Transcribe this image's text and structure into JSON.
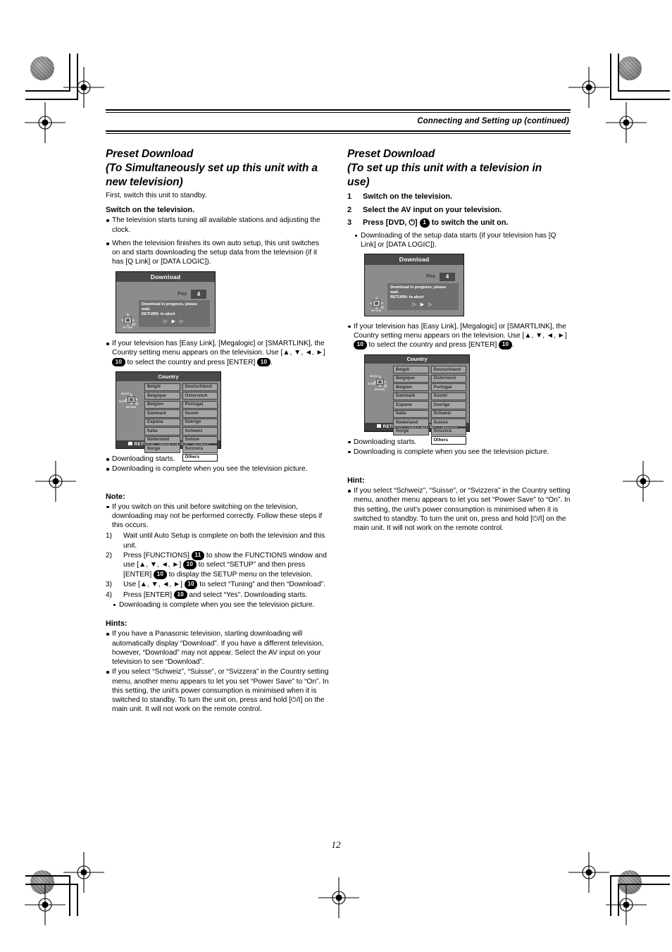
{
  "header": {
    "running_head": "Connecting and Setting up (continued)"
  },
  "page_number": "12",
  "left": {
    "title_line1": "Preset Download",
    "title_line2": "(To Simultaneously set up this unit with a",
    "title_line3": "new television)",
    "lead": "First, switch this unit to standby.",
    "subhead": "Switch on the television.",
    "bullet1": "The television starts tuning all available stations and adjusting the clock.",
    "bullet2": "When the television finishes its own auto setup, this unit switches on and starts downloading the setup data from the television (if it has [Q Link] or [DATA LOGIC]).",
    "bullet3_a": "If your television has [Easy Link], [Megalogic] or [SMARTLINK], the Country setting menu appears on the television. Use [",
    "bullet3_arrows": "▲, ▼, ◄, ►",
    "bullet3_b": "] ",
    "bullet3_key": "10",
    "bullet3_c": " to select the country and press [ENTER] ",
    "bullet3_key2": "10",
    "bullet3_d": ".",
    "bullet4": "Downloading starts.",
    "bullet5": "Downloading is complete when you see the television picture.",
    "note_head": "Note:",
    "note_bullet": "If you switch on this unit before switching on the television, downloading may not be performed correctly. Follow these steps if this occurs.",
    "steps": [
      {
        "n": "1)",
        "text": "Wait until Auto Setup is complete on both the television and this unit."
      },
      {
        "n": "2)",
        "text": "Press [FUNCTIONS] ⓫ to show the FUNCTIONS window and use [▲, ▼, ◄, ►] ⓪ to select “SETUP” and then press [ENTER] ⓪ to display the SETUP menu on the television."
      },
      {
        "n": "3)",
        "text": "Use [▲, ▼, ◄, ►] ⓪ to select “Tuning” and then “Download”."
      },
      {
        "n": "4)",
        "text": "Press [ENTER] ⓪ and select “Yes”. Downloading starts."
      }
    ],
    "step4_sub": "Downloading is complete when you see the television picture.",
    "hints_head": "Hints:",
    "hint1": "If you have a Panasonic television, starting downloading will automatically display “Download”. If you have a different television, however, “Download” may not appear. Select the AV input on your television to see “Download”.",
    "hint2": "If you select “Schweiz”, “Suisse”, or “Svizzera” in the Country setting menu, another menu appears to let you set “Power Save” to “On”. In this setting, the unit’s power consumption is minimised when it is switched to standby. To turn the unit on, press and hold [⏻/I] on the main unit. It will not work on the remote control."
  },
  "right": {
    "title_line1": "Preset Download",
    "title_line2": "(To set up this unit with a television in",
    "title_line3": "use)",
    "steps": [
      {
        "n": "1",
        "text": "Switch on the television."
      },
      {
        "n": "2",
        "text": "Select the AV input on your television."
      },
      {
        "n": "3",
        "text": "Press [DVD, ⏻] ① to switch the unit on."
      }
    ],
    "step3_key": "1",
    "step3_pre": "Press [DVD, ⏻] ",
    "step3_post": " to switch the unit on.",
    "bullet1": "Downloading of the setup data starts (if your television has [Q Link] or [DATA LOGIC]).",
    "bullet2_a": "If your television has [Easy Link], [Megalogic] or [SMARTLINK], the Country setting menu appears on the television. Use [",
    "bullet2_arrows": "▲, ▼, ◄, ►",
    "bullet2_b": "] ",
    "bullet2_key": "10",
    "bullet2_c": " to select the country and press [ENTER] ",
    "bullet2_key2": "10",
    "bullet2_d": ".",
    "bullet3": "Downloading starts.",
    "bullet4": "Downloading is complete when you see the television picture.",
    "hint_head": "Hint:",
    "hint1": "If you select “Schweiz”, “Suisse”, or “Svizzera” in the Country setting menu, another menu appears to let you set “Power Save” to “On”. In this setting, the unit’s power consumption is minimised when it is switched to standby. To turn the unit on, press and hold [⏻/I] on the main unit. It will not work on the remote control."
  },
  "download_screen": {
    "title": "Download",
    "pos_label": "Pos",
    "pos_value": "4",
    "msg_line1": "Download in progress, please wait.",
    "msg_line2": "RETURN:  to abort",
    "arrows": "▷ ▶ ▷",
    "pad_return": "RETURN"
  },
  "country_screen": {
    "title": "Country",
    "col1": [
      "België",
      "Belgique",
      "Belgien",
      "Danmark",
      "Espana",
      "Italia",
      "Nederland",
      "Norge"
    ],
    "col2": [
      "Deutschland",
      "Österreich",
      "Portugal",
      "Suomi",
      "Sverige",
      "Schweiz",
      "Suisse",
      "Svizzera",
      "Others"
    ],
    "selected": "Others",
    "footer": "RETURN : leave    ENTER : access",
    "pad_select": "SELECT",
    "pad_enter": "ENTER",
    "pad_return": "RETURN"
  }
}
